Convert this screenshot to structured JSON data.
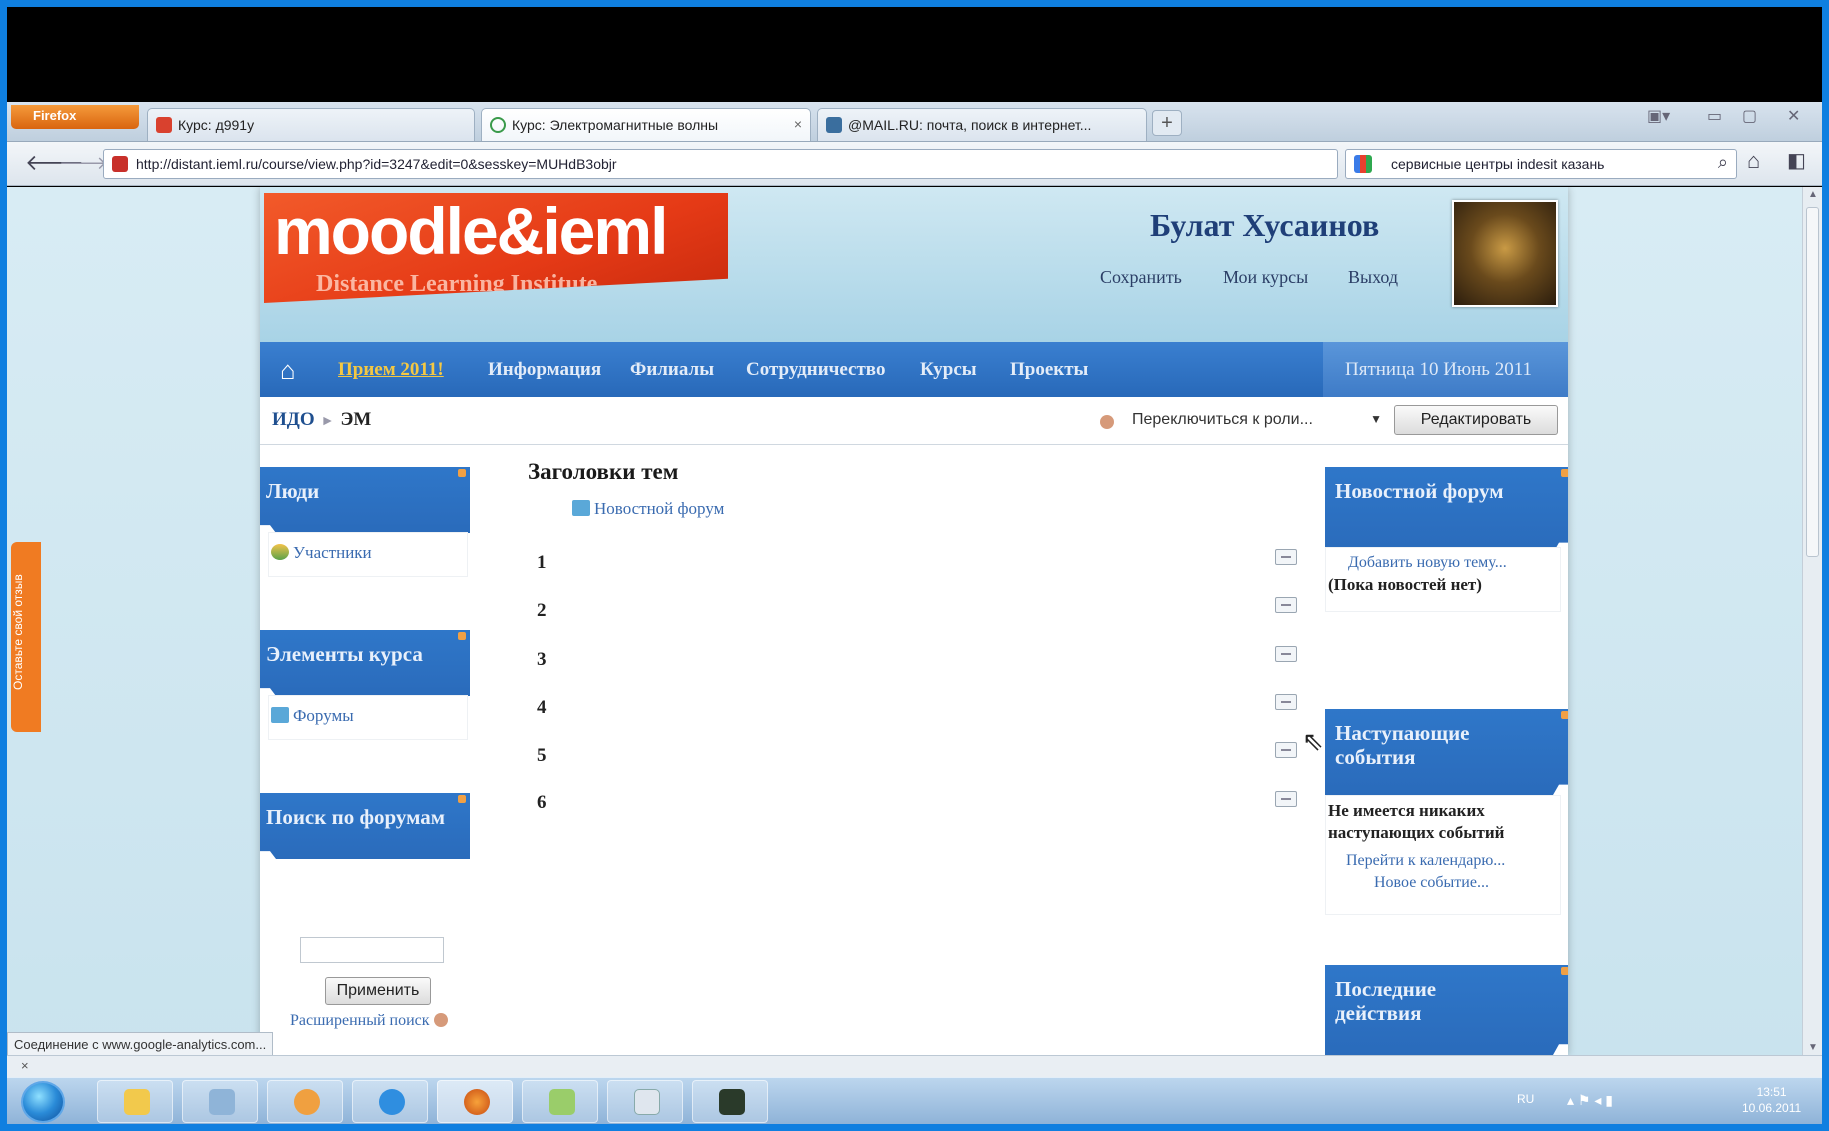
{
  "browser": {
    "app_button": "Firefox",
    "tabs": [
      {
        "label": "Курс: д991у",
        "active": false
      },
      {
        "label": "Курс: Электромагнитные волны",
        "active": true
      },
      {
        "label": "@MAIL.RU: почта, поиск в интернет...",
        "active": false
      }
    ],
    "new_tab": "+",
    "tab_close": "×",
    "url": "http://distant.ieml.ru/course/view.php?id=3247&edit=0&sesskey=MUHdB3objr",
    "search_query": "сервисные центры indesit казань",
    "status_text": "Соединение с www.google-analytics.com...",
    "status_close": "×"
  },
  "site": {
    "logo_title": "moodle&ieml",
    "logo_subtitle": "Distance Learning Institute",
    "user_name": "Булат Хусаинов",
    "header_links": [
      "Сохранить",
      "Мои курсы",
      "Выход"
    ],
    "menu": [
      "Прием 2011!",
      "Информация",
      "Филиалы",
      "Сотрудничество",
      "Курсы",
      "Проекты"
    ],
    "date": "Пятница 10 Июнь 2011",
    "breadcrumb": {
      "root": "ИДО",
      "separator": "►",
      "current": "ЭМ"
    },
    "role_switch": "Переключиться к роли...",
    "edit_button": "Редактировать"
  },
  "left_blocks": {
    "people": {
      "title": "Люди",
      "link": "Участники"
    },
    "course_elements": {
      "title": "Элементы курса",
      "link": "Форумы"
    },
    "forum_search": {
      "title": "Поиск по форумам",
      "button": "Применить",
      "advanced": "Расширенный поиск"
    }
  },
  "main": {
    "title": "Заголовки тем",
    "news_forum": "Новостной форум",
    "topics": [
      "1",
      "2",
      "3",
      "4",
      "5",
      "6"
    ]
  },
  "right_blocks": {
    "news": {
      "title": "Новостной форум",
      "add_link": "Добавить новую тему...",
      "empty": "(Пока новостей нет)"
    },
    "events": {
      "title": "Наступающие события",
      "empty": "Не имеется никаких наступающих событий",
      "calendar_link": "Перейти к календарю...",
      "new_event": "Новое событие..."
    },
    "recent": {
      "title": "Последние действия"
    }
  },
  "feedback_tab": "Оставьте свой отзыв",
  "taskbar": {
    "lang": "RU",
    "time": "13:51",
    "date": "10.06.2011"
  },
  "colors": {
    "accent": "#2a6bbb",
    "link": "#3a6bb0",
    "brand": "#e53a16",
    "menu_highlight": "#f4c843"
  }
}
